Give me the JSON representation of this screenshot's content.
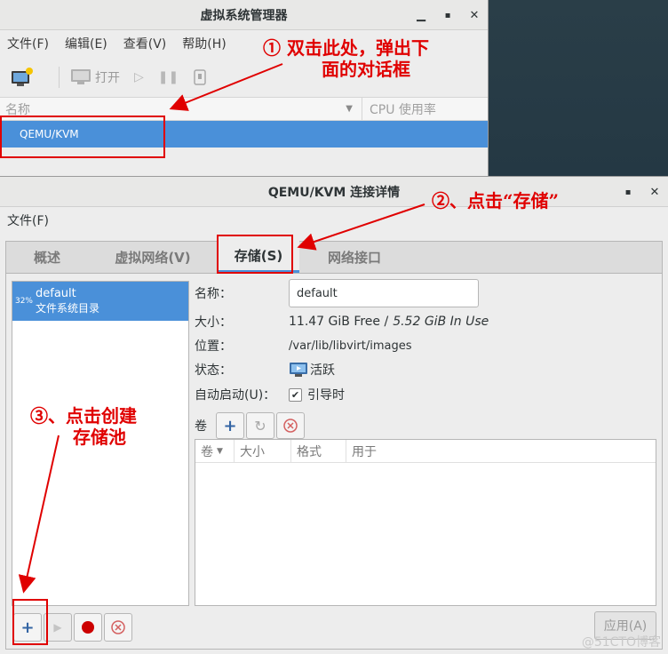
{
  "main_window": {
    "title": "虚拟系统管理器",
    "menu": [
      "文件(F)",
      "编辑(E)",
      "查看(V)",
      "帮助(H)"
    ],
    "toolbar": {
      "open_label": "打开"
    },
    "columns": {
      "name": "名称",
      "cpu": "CPU 使用率"
    },
    "connection": "QEMU/KVM"
  },
  "detail_window": {
    "title": "QEMU/KVM 连接详情",
    "menu": [
      "文件(F)"
    ],
    "tabs": [
      "概述",
      "虚拟网络(V)",
      "存储(S)",
      "网络接口"
    ],
    "active_tab": "存储(S)",
    "pool": {
      "percent": "32%",
      "name": "default",
      "type": "文件系统目录"
    },
    "info": {
      "name_label": "名称：",
      "name_value": "default",
      "size_label": "大小：",
      "size_free": "11.47 GiB Free /",
      "size_used": "5.52 GiB In Use",
      "location_label": "位置：",
      "location_value": "/var/lib/libvirt/images",
      "state_label": "状态：",
      "state_value": "活跃",
      "autostart_label": "自动启动(U)：",
      "autostart_value": "引导时",
      "volumes_label": "卷"
    },
    "volume_columns": [
      "卷",
      "大小",
      "格式",
      "用于"
    ],
    "apply_label": "应用(A)"
  },
  "annotations": {
    "step1_line1": "① 双击此处，弹出下",
    "step1_line2": "面的对话框",
    "step2": "②、点击“存储”",
    "step3_line1": "③、点击创建",
    "step3_line2": "存储池"
  },
  "watermark": "@51CTO博客",
  "colors": {
    "selection": "#4a90d9",
    "annotation": "#e00000"
  }
}
